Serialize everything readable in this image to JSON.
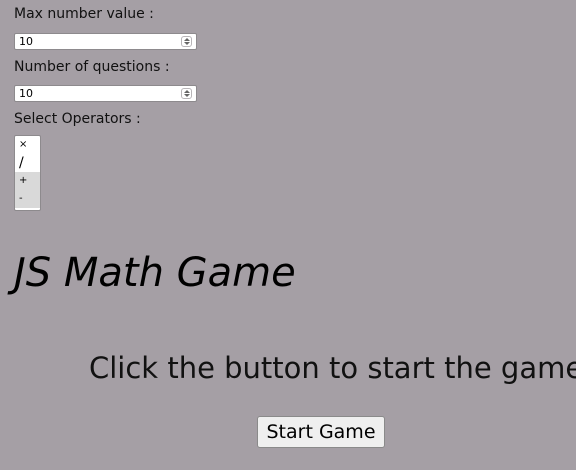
{
  "settings": {
    "max_label": "Max number value :",
    "max_value": "10",
    "questions_label": "Number of questions :",
    "questions_value": "10",
    "operators_label": "Select Operators :",
    "operators": [
      "×",
      "/",
      "+",
      "-"
    ]
  },
  "game": {
    "title": "JS Math Game",
    "instruction": "Click the button to start the game",
    "start_label": "Start Game"
  }
}
